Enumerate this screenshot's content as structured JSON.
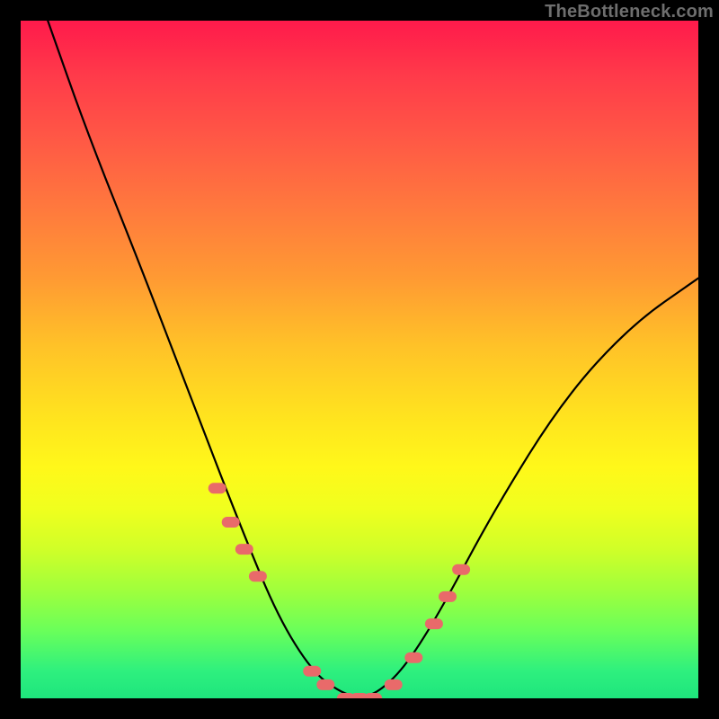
{
  "watermark": "TheBottleneck.com",
  "chart_data": {
    "type": "line",
    "title": "",
    "xlabel": "",
    "ylabel": "",
    "xlim": [
      0,
      100
    ],
    "ylim": [
      0,
      100
    ],
    "series": [
      {
        "name": "bottleneck-curve",
        "x": [
          4,
          10,
          18,
          26,
          33,
          38,
          43,
          47,
          50,
          53,
          57,
          62,
          70,
          80,
          90,
          100
        ],
        "values": [
          100,
          83,
          63,
          42,
          24,
          12,
          4,
          1,
          0,
          1,
          5,
          13,
          28,
          44,
          55,
          62
        ]
      }
    ],
    "markers": {
      "name": "highlight-dots",
      "color": "#e96a6a",
      "x": [
        29,
        31,
        33,
        35,
        43,
        45,
        48,
        50,
        52,
        55,
        58,
        61,
        63,
        65
      ],
      "values": [
        31,
        26,
        22,
        18,
        4,
        2,
        0,
        0,
        0,
        2,
        6,
        11,
        15,
        19
      ]
    }
  }
}
